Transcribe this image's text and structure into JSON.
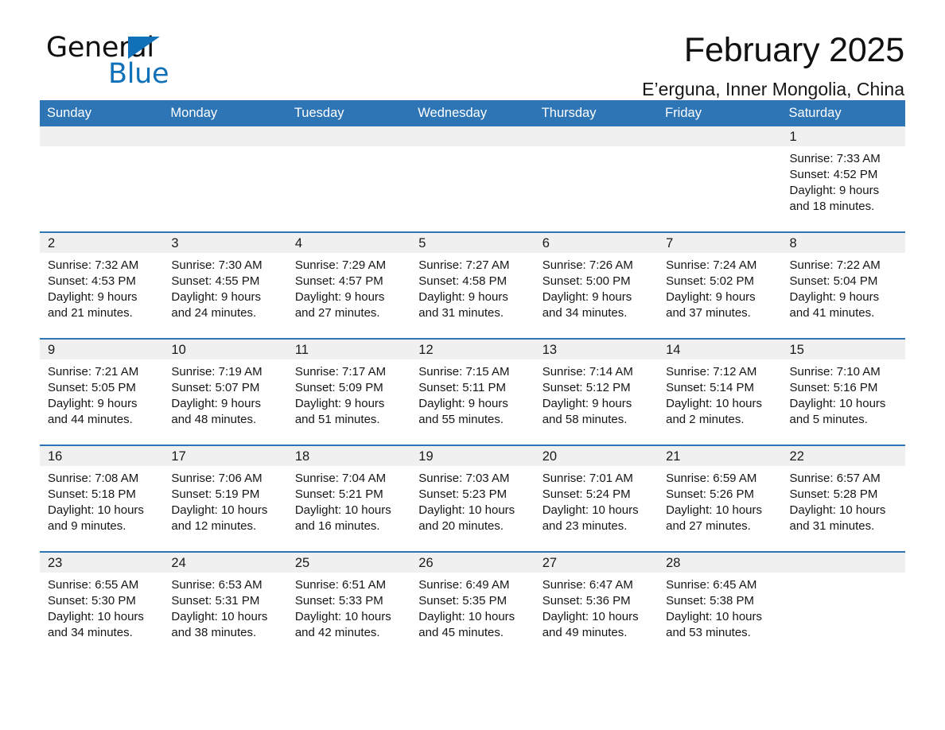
{
  "logo": {
    "line1": "General",
    "line2": "Blue",
    "triangle_color": "#1071b8",
    "text_color": "#0f0f0f"
  },
  "header": {
    "title": "February 2025",
    "subtitle": "E’erguna, Inner Mongolia, China"
  },
  "colors": {
    "header_blue": "#2e75b6",
    "row_rule_blue": "#2e75b6",
    "daynum_band": "#f0f0f0",
    "page_background": "#ffffff"
  },
  "calendar": {
    "weekday_headers": [
      "Sunday",
      "Monday",
      "Tuesday",
      "Wednesday",
      "Thursday",
      "Friday",
      "Saturday"
    ],
    "labels": {
      "sunrise": "Sunrise:",
      "sunset": "Sunset:",
      "daylight": "Daylight:"
    },
    "weeks": [
      [
        {
          "empty": true
        },
        {
          "empty": true
        },
        {
          "empty": true
        },
        {
          "empty": true
        },
        {
          "empty": true
        },
        {
          "empty": true
        },
        {
          "day": "1",
          "sunrise": "Sunrise: 7:33 AM",
          "sunset": "Sunset: 4:52 PM",
          "daylight_1": "Daylight: 9 hours",
          "daylight_2": "and 18 minutes."
        }
      ],
      [
        {
          "day": "2",
          "sunrise": "Sunrise: 7:32 AM",
          "sunset": "Sunset: 4:53 PM",
          "daylight_1": "Daylight: 9 hours",
          "daylight_2": "and 21 minutes."
        },
        {
          "day": "3",
          "sunrise": "Sunrise: 7:30 AM",
          "sunset": "Sunset: 4:55 PM",
          "daylight_1": "Daylight: 9 hours",
          "daylight_2": "and 24 minutes."
        },
        {
          "day": "4",
          "sunrise": "Sunrise: 7:29 AM",
          "sunset": "Sunset: 4:57 PM",
          "daylight_1": "Daylight: 9 hours",
          "daylight_2": "and 27 minutes."
        },
        {
          "day": "5",
          "sunrise": "Sunrise: 7:27 AM",
          "sunset": "Sunset: 4:58 PM",
          "daylight_1": "Daylight: 9 hours",
          "daylight_2": "and 31 minutes."
        },
        {
          "day": "6",
          "sunrise": "Sunrise: 7:26 AM",
          "sunset": "Sunset: 5:00 PM",
          "daylight_1": "Daylight: 9 hours",
          "daylight_2": "and 34 minutes."
        },
        {
          "day": "7",
          "sunrise": "Sunrise: 7:24 AM",
          "sunset": "Sunset: 5:02 PM",
          "daylight_1": "Daylight: 9 hours",
          "daylight_2": "and 37 minutes."
        },
        {
          "day": "8",
          "sunrise": "Sunrise: 7:22 AM",
          "sunset": "Sunset: 5:04 PM",
          "daylight_1": "Daylight: 9 hours",
          "daylight_2": "and 41 minutes."
        }
      ],
      [
        {
          "day": "9",
          "sunrise": "Sunrise: 7:21 AM",
          "sunset": "Sunset: 5:05 PM",
          "daylight_1": "Daylight: 9 hours",
          "daylight_2": "and 44 minutes."
        },
        {
          "day": "10",
          "sunrise": "Sunrise: 7:19 AM",
          "sunset": "Sunset: 5:07 PM",
          "daylight_1": "Daylight: 9 hours",
          "daylight_2": "and 48 minutes."
        },
        {
          "day": "11",
          "sunrise": "Sunrise: 7:17 AM",
          "sunset": "Sunset: 5:09 PM",
          "daylight_1": "Daylight: 9 hours",
          "daylight_2": "and 51 minutes."
        },
        {
          "day": "12",
          "sunrise": "Sunrise: 7:15 AM",
          "sunset": "Sunset: 5:11 PM",
          "daylight_1": "Daylight: 9 hours",
          "daylight_2": "and 55 minutes."
        },
        {
          "day": "13",
          "sunrise": "Sunrise: 7:14 AM",
          "sunset": "Sunset: 5:12 PM",
          "daylight_1": "Daylight: 9 hours",
          "daylight_2": "and 58 minutes."
        },
        {
          "day": "14",
          "sunrise": "Sunrise: 7:12 AM",
          "sunset": "Sunset: 5:14 PM",
          "daylight_1": "Daylight: 10 hours",
          "daylight_2": "and 2 minutes."
        },
        {
          "day": "15",
          "sunrise": "Sunrise: 7:10 AM",
          "sunset": "Sunset: 5:16 PM",
          "daylight_1": "Daylight: 10 hours",
          "daylight_2": "and 5 minutes."
        }
      ],
      [
        {
          "day": "16",
          "sunrise": "Sunrise: 7:08 AM",
          "sunset": "Sunset: 5:18 PM",
          "daylight_1": "Daylight: 10 hours",
          "daylight_2": "and 9 minutes."
        },
        {
          "day": "17",
          "sunrise": "Sunrise: 7:06 AM",
          "sunset": "Sunset: 5:19 PM",
          "daylight_1": "Daylight: 10 hours",
          "daylight_2": "and 12 minutes."
        },
        {
          "day": "18",
          "sunrise": "Sunrise: 7:04 AM",
          "sunset": "Sunset: 5:21 PM",
          "daylight_1": "Daylight: 10 hours",
          "daylight_2": "and 16 minutes."
        },
        {
          "day": "19",
          "sunrise": "Sunrise: 7:03 AM",
          "sunset": "Sunset: 5:23 PM",
          "daylight_1": "Daylight: 10 hours",
          "daylight_2": "and 20 minutes."
        },
        {
          "day": "20",
          "sunrise": "Sunrise: 7:01 AM",
          "sunset": "Sunset: 5:24 PM",
          "daylight_1": "Daylight: 10 hours",
          "daylight_2": "and 23 minutes."
        },
        {
          "day": "21",
          "sunrise": "Sunrise: 6:59 AM",
          "sunset": "Sunset: 5:26 PM",
          "daylight_1": "Daylight: 10 hours",
          "daylight_2": "and 27 minutes."
        },
        {
          "day": "22",
          "sunrise": "Sunrise: 6:57 AM",
          "sunset": "Sunset: 5:28 PM",
          "daylight_1": "Daylight: 10 hours",
          "daylight_2": "and 31 minutes."
        }
      ],
      [
        {
          "day": "23",
          "sunrise": "Sunrise: 6:55 AM",
          "sunset": "Sunset: 5:30 PM",
          "daylight_1": "Daylight: 10 hours",
          "daylight_2": "and 34 minutes."
        },
        {
          "day": "24",
          "sunrise": "Sunrise: 6:53 AM",
          "sunset": "Sunset: 5:31 PM",
          "daylight_1": "Daylight: 10 hours",
          "daylight_2": "and 38 minutes."
        },
        {
          "day": "25",
          "sunrise": "Sunrise: 6:51 AM",
          "sunset": "Sunset: 5:33 PM",
          "daylight_1": "Daylight: 10 hours",
          "daylight_2": "and 42 minutes."
        },
        {
          "day": "26",
          "sunrise": "Sunrise: 6:49 AM",
          "sunset": "Sunset: 5:35 PM",
          "daylight_1": "Daylight: 10 hours",
          "daylight_2": "and 45 minutes."
        },
        {
          "day": "27",
          "sunrise": "Sunrise: 6:47 AM",
          "sunset": "Sunset: 5:36 PM",
          "daylight_1": "Daylight: 10 hours",
          "daylight_2": "and 49 minutes."
        },
        {
          "day": "28",
          "sunrise": "Sunrise: 6:45 AM",
          "sunset": "Sunset: 5:38 PM",
          "daylight_1": "Daylight: 10 hours",
          "daylight_2": "and 53 minutes."
        },
        {
          "empty": true
        }
      ]
    ]
  }
}
